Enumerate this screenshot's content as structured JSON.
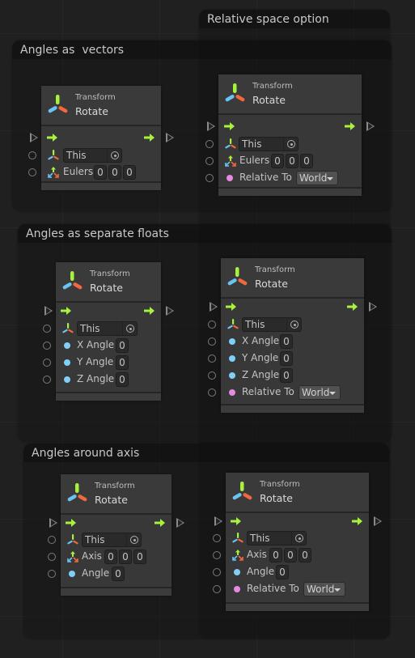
{
  "groups": [
    {
      "title": "Relative space option"
    },
    {
      "title": "Angles as  vectors"
    },
    {
      "title": "Angles as separate floats"
    },
    {
      "title": "Angles around axis"
    }
  ],
  "colors": {
    "flow_arrow": "#a6f23c",
    "float_port": "#7fd0f8",
    "enum_port": "#e68ae0",
    "axis_green": "#a6f23c",
    "axis_blue": "#6ac3f5",
    "axis_red": "#f2673b"
  },
  "nodes": [
    {
      "category": "Transform",
      "title": "Rotate",
      "target": "This",
      "eulers_label": "Eulers",
      "eulers": [
        "0",
        "0",
        "0"
      ]
    },
    {
      "category": "Transform",
      "title": "Rotate",
      "target": "This",
      "eulers_label": "Eulers",
      "eulers": [
        "0",
        "0",
        "0"
      ],
      "relative_label": "Relative To",
      "relative_value": "World"
    },
    {
      "category": "Transform",
      "title": "Rotate",
      "target": "This",
      "x_label": "X Angle",
      "x_value": "0",
      "y_label": "Y Angle",
      "y_value": "0",
      "z_label": "Z Angle",
      "z_value": "0"
    },
    {
      "category": "Transform",
      "title": "Rotate",
      "target": "This",
      "x_label": "X Angle",
      "x_value": "0",
      "y_label": "Y Angle",
      "y_value": "0",
      "z_label": "Z Angle",
      "z_value": "0",
      "relative_label": "Relative To",
      "relative_value": "World"
    },
    {
      "category": "Transform",
      "title": "Rotate",
      "target": "This",
      "axis_label": "Axis",
      "axis": [
        "0",
        "0",
        "0"
      ],
      "angle_label": "Angle",
      "angle_value": "0"
    },
    {
      "category": "Transform",
      "title": "Rotate",
      "target": "This",
      "axis_label": "Axis",
      "axis": [
        "0",
        "0",
        "0"
      ],
      "angle_label": "Angle",
      "angle_value": "0",
      "relative_label": "Relative To",
      "relative_value": "World"
    }
  ]
}
